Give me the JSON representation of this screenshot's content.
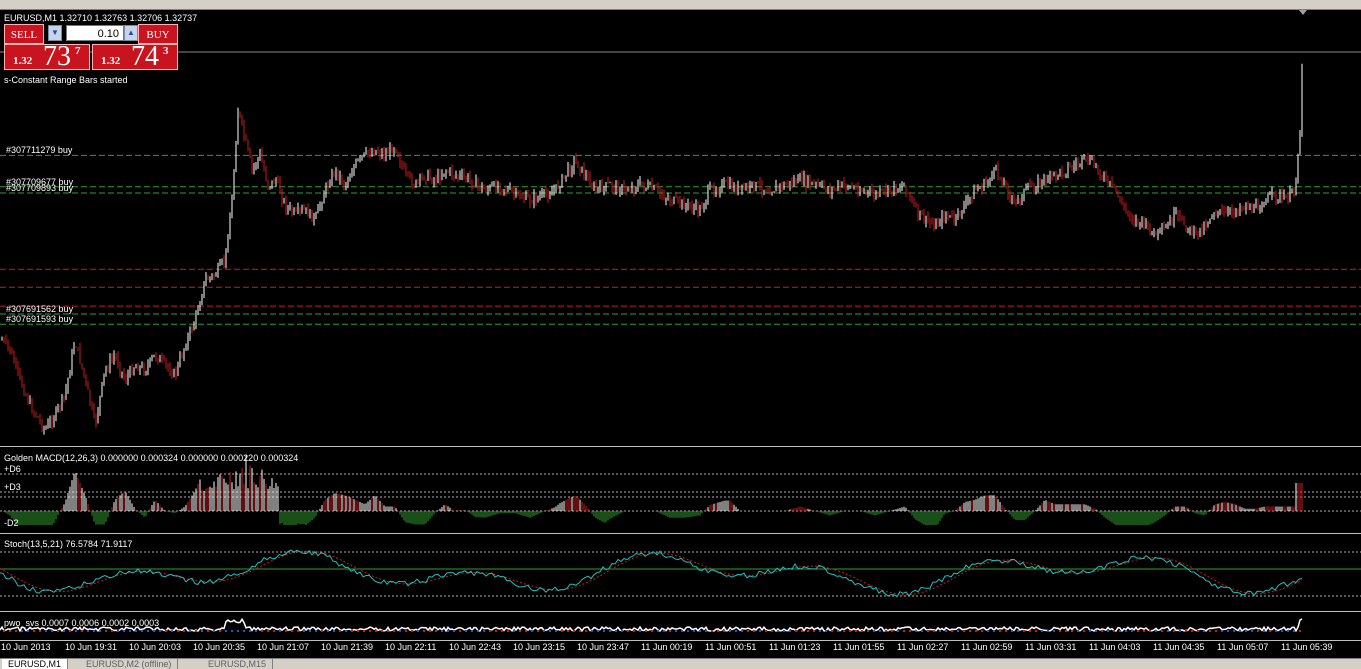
{
  "window": {
    "symbol_header": "EURUSD,M1  1.32710 1.32763 1.32706 1.32737",
    "status_message": "s-Constant Range Bars started"
  },
  "one_click": {
    "sell_label": "SELL",
    "buy_label": "BUY",
    "lots_value": "0.10",
    "sell_price_small": "1.32",
    "sell_price_big": "73",
    "sell_price_sup": "7",
    "buy_price_small": "1.32",
    "buy_price_big": "74",
    "buy_price_sup": "3"
  },
  "order_lines": [
    {
      "label": "#307711279 buy",
      "price": 1.3256,
      "color": "#2fa02f"
    },
    {
      "label": "#307709677 buy",
      "price": 1.3252,
      "color": "#2fa02f"
    },
    {
      "label": "#307709893 buy",
      "price": 1.32512,
      "color": "#2fa02f"
    },
    {
      "label": "",
      "price": 1.32415,
      "color": "#c81e1e"
    },
    {
      "label": "",
      "price": 1.32392,
      "color": "#c81e1e"
    },
    {
      "label": "",
      "price": 1.32368,
      "color": "#c81e1e"
    },
    {
      "label": "#307691562 buy",
      "price": 1.32358,
      "color": "#2fa02f"
    },
    {
      "label": "#307691593 buy",
      "price": 1.32345,
      "color": "#2fa02f"
    }
  ],
  "indicators": {
    "macd_label": "Golden MACD(12,26,3) 0.000000 0.000324 0.000000 0.000220 0.000324",
    "macd_levels": [
      "+D6",
      "+D3",
      "-D2"
    ],
    "stoch_label": "Stoch(13,5,21) 76.5784 71.9117",
    "pwo_label": "pwo_svs 0.0007 0.0006 0.0002 0.0003"
  },
  "time_axis": [
    "10 Jun 2013",
    "10 Jun 19:31",
    "10 Jun 20:03",
    "10 Jun 20:35",
    "10 Jun 21:07",
    "10 Jun 21:39",
    "10 Jun 22:11",
    "10 Jun 22:43",
    "10 Jun 23:15",
    "10 Jun 23:47",
    "11 Jun 00:19",
    "11 Jun 00:51",
    "11 Jun 01:23",
    "11 Jun 01:55",
    "11 Jun 02:27",
    "11 Jun 02:59",
    "11 Jun 03:31",
    "11 Jun 04:03",
    "11 Jun 04:35",
    "11 Jun 05:07",
    "11 Jun 05:39"
  ],
  "tabs": [
    {
      "label": "EURUSD,M1",
      "active": true
    },
    {
      "label": "EURUSD,M2 (offline)",
      "active": false
    },
    {
      "label": "EURUSD,M15",
      "active": false
    }
  ],
  "colors": {
    "bull": "#ffffff",
    "bear": "#c81e1e",
    "macd_green": "#2fa02f",
    "stoch_main": "#20c0c0",
    "stoch_signal": "#c81e1e"
  }
}
